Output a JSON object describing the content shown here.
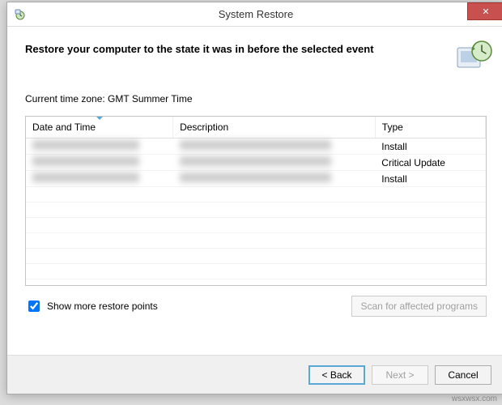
{
  "titlebar": {
    "title": "System Restore"
  },
  "header": {
    "heading": "Restore your computer to the state it was in before the selected event"
  },
  "timezone": {
    "label": "Current time zone: GMT Summer Time"
  },
  "table": {
    "columns": {
      "date": "Date and Time",
      "desc": "Description",
      "type": "Type"
    },
    "rows": [
      {
        "date": "",
        "desc": "",
        "type": "Install"
      },
      {
        "date": "",
        "desc": "",
        "type": "Critical Update"
      },
      {
        "date": "",
        "desc": "",
        "type": "Install"
      }
    ]
  },
  "options": {
    "show_more_label": "Show more restore points",
    "show_more_checked": true,
    "scan_label": "Scan for affected programs"
  },
  "footer": {
    "back": "< Back",
    "next": "Next >",
    "cancel": "Cancel"
  },
  "watermark": "wsxwsx.com"
}
